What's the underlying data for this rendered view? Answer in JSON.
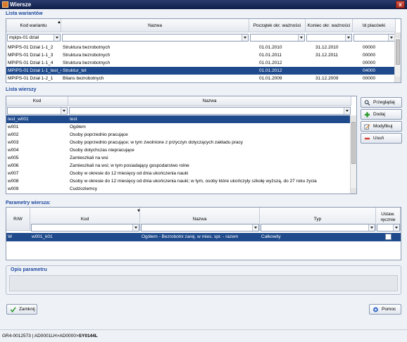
{
  "window": {
    "title": "Wiersze",
    "close_glyph": "x"
  },
  "variants": {
    "section_label": "Lista wariantów",
    "columns": [
      "Kod wariantu",
      "Nazwa",
      "Początek okr. ważności",
      "Koniec okr. ważności",
      "Id placówki"
    ],
    "filter_value": "mpips-01 dział",
    "rows": [
      [
        "MPIPS-01 Dział 1-1_2",
        "Struktura bezrobotnych",
        "01.01.2010",
        "31.12.2010",
        "00000"
      ],
      [
        "MPIPS-01 Dział 1-1_3",
        "Struktura bezrobotnych",
        "01.01.2011",
        "31.12.2011",
        "00000"
      ],
      [
        "MPIPS-01 Dział 1-1_4",
        "Struktura bezrobotnych",
        "01.01.2012",
        "",
        "00000"
      ],
      [
        "MPIPS-01 Dział 1-1_test_4",
        "Struktur_tet",
        "01.01.2012",
        "",
        "04000"
      ],
      [
        "MPIPS-01 Dział 1-2_1",
        "Bilans bezrobotnych",
        "01.01.2009",
        "31.12.2009",
        "00000"
      ]
    ],
    "selected_index": 3
  },
  "lines": {
    "section_label": "Lista wierszy",
    "columns": [
      "Kod",
      "Nazwa"
    ],
    "rows": [
      [
        "test_w001",
        "test"
      ],
      [
        "w001",
        "Ogółem"
      ],
      [
        "w002",
        "Osoby poprzednio pracujące"
      ],
      [
        "w003",
        "Osoby poprzednio pracujące; w tym zwolnione z przyczyn dotyczących zakładu pracy"
      ],
      [
        "w004",
        "Osoby dotychczas niepracujące"
      ],
      [
        "w005",
        "Zamieszkali na wsi"
      ],
      [
        "w006",
        "Zamieszkali na wsi; w tym posiadający gospodarstwo rolne"
      ],
      [
        "w007",
        "Osoby w okresie do 12 miesięcy od dnia ukończenia nauki"
      ],
      [
        "w008",
        "Osoby w okresie do 12 miesięcy od dnia ukończenia nauki; w tym, osoby które ukończyły szkołę wyższą, do 27 roku życia"
      ],
      [
        "w009",
        "Cudzoziemcy"
      ]
    ],
    "selected_index": 0
  },
  "side_buttons": {
    "browse": "Przeglądaj",
    "add": "Dodaj",
    "modify": "Modyfikuj",
    "remove": "Usuń"
  },
  "params": {
    "section_label": "Parametry wiersza:",
    "columns": [
      "R/W",
      "Kod",
      "Nazwa",
      "Typ",
      "Ustaw. ręcznie"
    ],
    "rows": [
      [
        "W",
        "w001_k01",
        "Ogółem - Bezrobotni zarej. w mies. spr. - razem",
        "Całkowity"
      ]
    ],
    "selected_index": 0
  },
  "description": {
    "section_label": "Opis parametru"
  },
  "footer": {
    "close": "Zamknij",
    "help": "Pomoc"
  },
  "status": {
    "prefix": "GR4-0012573 | AD0001LH>AD0000>",
    "bold": "SY0144L"
  },
  "colors": {
    "selection": "#1f4a8c",
    "section_label": "#1e4aa0",
    "background": "#eef1f6"
  }
}
